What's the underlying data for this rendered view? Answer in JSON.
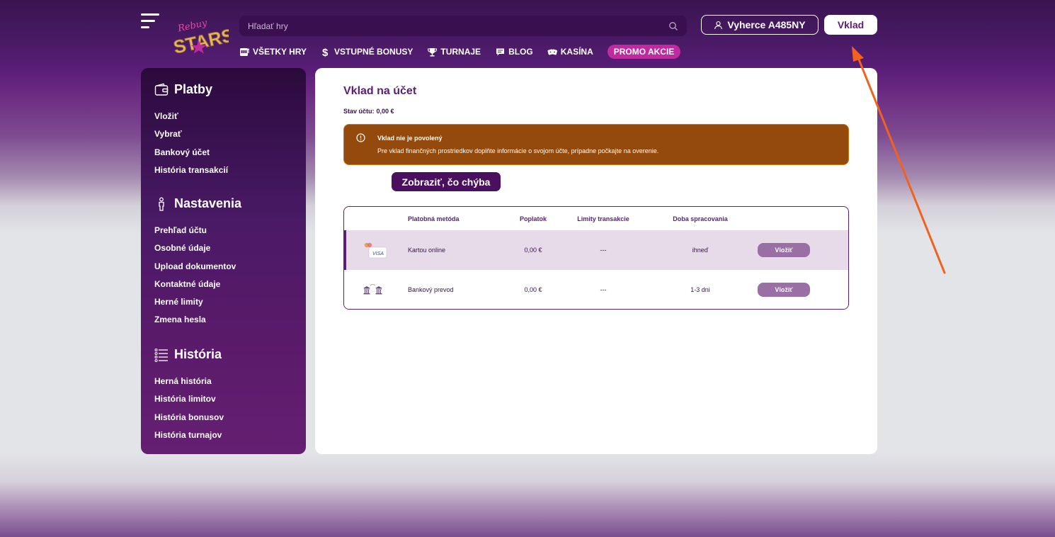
{
  "header": {
    "search_placeholder": "Hľadať hry",
    "user_label": "Vyherce A485NY",
    "deposit_label": "Vklad",
    "nav": [
      {
        "label": "VŠETKY HRY",
        "icon": "slot-machine-icon"
      },
      {
        "label": "VSTUPNÉ BONUSY",
        "icon": "dollar-icon"
      },
      {
        "label": "TURNAJE",
        "icon": "trophy-icon"
      },
      {
        "label": "BLOG",
        "icon": "chat-icon"
      },
      {
        "label": "KASÍNA",
        "icon": "casino-chips-icon"
      }
    ],
    "promo_label": "PROMO AKCIE"
  },
  "sidebar": {
    "payments": {
      "title": "Platby",
      "icon": "wallet-icon",
      "items": [
        "Vložiť",
        "Vybrať",
        "Bankový účet",
        "História transakcií"
      ]
    },
    "settings": {
      "title": "Nastavenia",
      "icon": "person-icon",
      "items": [
        "Prehľad účtu",
        "Osobné údaje",
        "Upload dokumentov",
        "Kontaktné údaje",
        "Herné limity",
        "Zmena hesla"
      ]
    },
    "history": {
      "title": "História",
      "icon": "list-icon",
      "items": [
        "Herná história",
        "História limitov",
        "História bonusov",
        "História turnajov"
      ]
    }
  },
  "main": {
    "title": "Vklad na účet",
    "balance_label": "Stav účtu:",
    "balance_value": "0,00 €",
    "alert": {
      "title": "Vklad nie je povolený",
      "message": "Pre vklad finančných prostriedkov doplňte informácie o svojom účte, prípadne počkajte na overenie."
    },
    "show_missing_label": "Zobraziť, čo chýba",
    "table": {
      "headers": [
        "Platobná metóda",
        "Poplatok",
        "Limity transakcie",
        "Doba spracovania"
      ],
      "rows": [
        {
          "method": "Kartou online",
          "fee": "0,00 €",
          "limits": "---",
          "time": "ihneď",
          "action": "Vložiť",
          "icon": "card-visa-icon"
        },
        {
          "method": "Bankový prevod",
          "fee": "0,00 €",
          "limits": "---",
          "time": "1-3 dni",
          "action": "Vložiť",
          "icon": "bank-transfer-icon"
        }
      ]
    }
  },
  "colors": {
    "brand_purple": "#5a1e78",
    "alert_brown": "#944a0c",
    "promo_pink": "#c02aa0",
    "arrow_orange": "#f0621e"
  }
}
